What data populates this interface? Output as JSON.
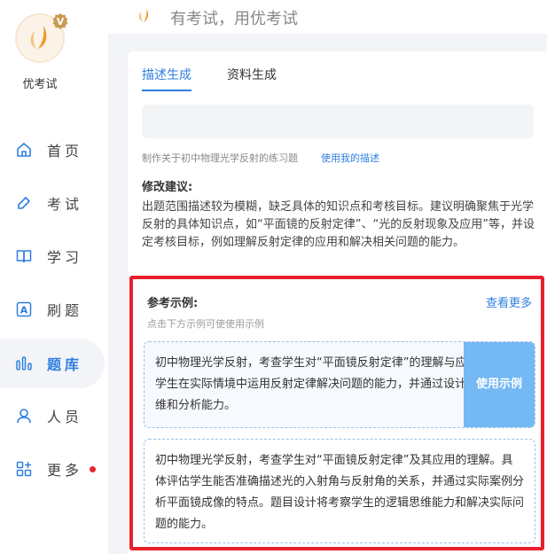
{
  "app": {
    "name": "优考试",
    "badge_letter": "V",
    "slogan": "有考试，用优考试"
  },
  "sidebar": {
    "items": [
      {
        "label": "首页",
        "icon": "home-icon",
        "active": false
      },
      {
        "label": "考试",
        "icon": "pencil-icon",
        "active": false
      },
      {
        "label": "学习",
        "icon": "book-icon",
        "active": false
      },
      {
        "label": "刷题",
        "icon": "letter-a-icon",
        "active": false
      },
      {
        "label": "题库",
        "icon": "bar-chart-icon",
        "active": true
      },
      {
        "label": "人员",
        "icon": "person-icon",
        "active": false
      },
      {
        "label": "更多",
        "icon": "grid-plus-icon",
        "active": false,
        "has_notification": true
      }
    ]
  },
  "tabs": [
    {
      "label": "描述生成",
      "active": true
    },
    {
      "label": "资料生成",
      "active": false
    }
  ],
  "description": {
    "value": "",
    "hint_text": "制作关于初中物理光学反射的练习题",
    "use_my_description_link": "使用我的描述"
  },
  "suggestion": {
    "title": "修改建议:",
    "body": "出题范围描述较为模糊，缺乏具体的知识点和考核目标。建议明确聚焦于光学反射的具体知识点，如“平面镜的反射定律”、“光的反射现象及应用”等，并设定考核目标，例如理解反射定律的应用和解决相关问题的能力。"
  },
  "examples": {
    "title": "参考示例:",
    "view_more": "查看更多",
    "hint": "点击下方示例可使使用示例",
    "use_button": "使用示例",
    "items": [
      "初中物理光学反射，考查学生对“平面镜反射定律”的理解与应用。评估学生在实际情境中运用反射定律解决问题的能力，并通过设计考察逻辑思维和分析能力。",
      "初中物理光学反射，考查学生对“平面镜反射定律”及其应用的理解。具体评估学生能否准确描述光的入射角与反射角的关系，并通过实际案例分析平面镜成像的特点。题目设计将考察学生的逻辑思维能力和解决实际问题的能力。"
    ]
  },
  "colors": {
    "accent": "#2f7fe0",
    "highlight_frame": "#e8202b",
    "notification_dot": "#e8272f",
    "use_button_bg": "#74b8f4",
    "logo_orange": "#f0a030"
  }
}
